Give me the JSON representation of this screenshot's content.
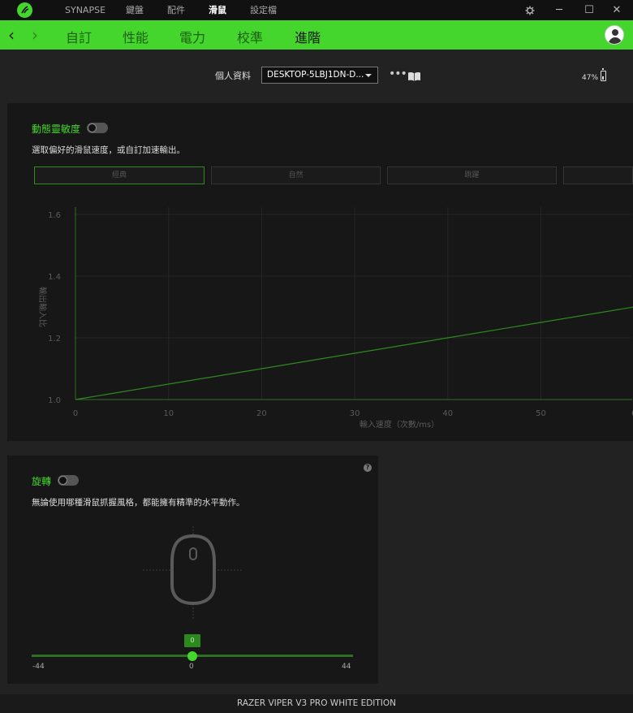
{
  "topbar": {
    "nav": [
      "SYNAPSE",
      "鍵盤",
      "配件",
      "滑鼠",
      "設定檔"
    ],
    "active_index": 3,
    "window_controls": {
      "minimize": "─",
      "maximize": "☐",
      "close": "✕"
    },
    "settings_icon": "gear-icon"
  },
  "subnav": {
    "back": "‹",
    "forward": "›",
    "tabs": [
      "自訂",
      "性能",
      "電力",
      "校準",
      "進階"
    ],
    "active_index": 4,
    "accent": "#44d62c"
  },
  "profile": {
    "label": "個人資料",
    "selected": "DESKTOP-5LBJ1DN-D...",
    "more": "•••",
    "battery": "47%"
  },
  "dynamic_sensitivity": {
    "title": "動態靈敏度",
    "enabled": false,
    "description": "選取偏好的滑鼠速度，或自訂加速輸出。",
    "presets": [
      "經典",
      "自然",
      "跳躍",
      ""
    ],
    "active_preset": 0,
    "chart_data": {
      "type": "line",
      "xlabel": "輸入速度（次數/ms）",
      "ylabel": "輸出輸入比",
      "x_ticks": [
        "0",
        "10",
        "20",
        "30",
        "40",
        "50",
        "6"
      ],
      "y_ticks": [
        "1.0",
        "1.2",
        "1.4",
        "1.6"
      ],
      "xlim": [
        0,
        60
      ],
      "ylim": [
        1.0,
        1.6
      ],
      "series": [
        {
          "x": [
            0,
            60
          ],
          "y": [
            1.0,
            1.3
          ],
          "color": "#2f8a20"
        }
      ]
    }
  },
  "rotation": {
    "title": "旋轉",
    "enabled": false,
    "help": "?",
    "description": "無論使用哪種滑鼠抓握風格，都能擁有精準的水平動作。",
    "slider": {
      "value": "0",
      "min": "-44",
      "mid": "0",
      "max": "44",
      "fraction": 0.5
    }
  },
  "footer": {
    "device": "RAZER VIPER V3 PRO WHITE EDITION"
  }
}
